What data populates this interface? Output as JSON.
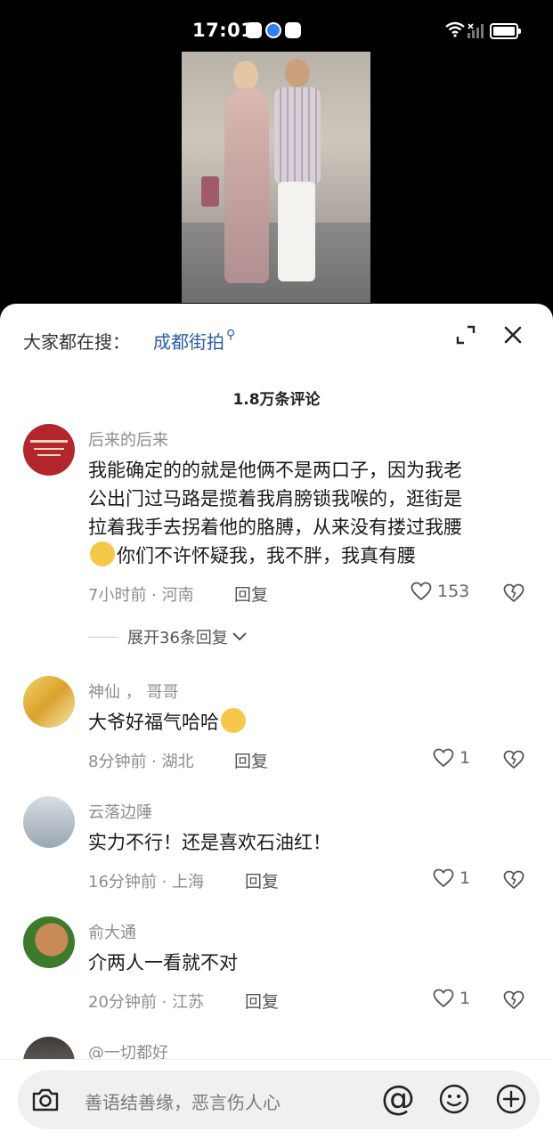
{
  "status_bar": {
    "time": "17:01"
  },
  "search": {
    "prefix": "大家都在搜：",
    "term": "成都街拍"
  },
  "comments_header": {
    "count": "1.8万条评论"
  },
  "comments": [
    {
      "username": "后来的后来",
      "text_lines": [
        "我能确定的的就是他俩不是两口子，因为我老",
        "公出门过马路是揽着我肩膀锁我喉的，逛街是",
        "拉着我手去拐着他的胳膊，从来没有搂过我腰"
      ],
      "text_last": "你们不许怀疑我，我不胖，我真有腰",
      "time": "7小时前",
      "location": "河南",
      "reply_label": "回复",
      "likes": "153",
      "expand_label": "展开36条回复"
    },
    {
      "username": "神仙 ， 哥哥",
      "text": "大爷好福气哈哈",
      "time": "8分钟前",
      "location": "湖北",
      "reply_label": "回复",
      "likes": "1"
    },
    {
      "username": "云落边陲",
      "text": "实力不行！还是喜欢石油红！",
      "time": "16分钟前",
      "location": "上海",
      "reply_label": "回复",
      "likes": "1"
    },
    {
      "username": "俞大通",
      "text": "介两人一看就不对",
      "time": "20分钟前",
      "location": "江苏",
      "reply_label": "回复",
      "likes": "1"
    },
    {
      "username": "@一切都好"
    }
  ],
  "input": {
    "placeholder": "善语结善缘，恶言伤人心"
  },
  "colors": {
    "link": "#2b5ea7",
    "meta": "#8d8d8d",
    "sheet_bg": "#ffffff"
  }
}
